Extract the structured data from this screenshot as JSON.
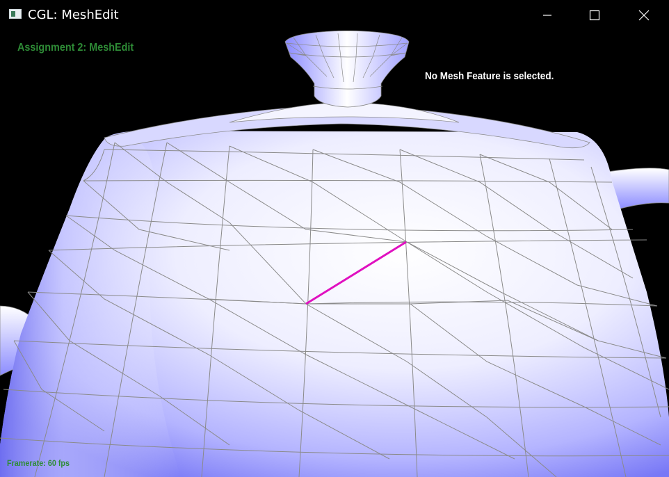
{
  "window": {
    "title": "CGL: MeshEdit",
    "controls": {
      "minimize": "minimize-icon",
      "maximize": "maximize-icon",
      "close": "close-icon"
    }
  },
  "overlay": {
    "assignment_title": "Assignment 2: MeshEdit",
    "status": "No Mesh Feature is selected.",
    "framerate": "Framerate: 60 fps"
  },
  "colors": {
    "overlay_green": "#2e8b36",
    "mesh_fill_light": "#ffffff",
    "mesh_fill_dark": "#7b7bff",
    "wireframe": "#8a8a8a",
    "highlight_edge": "#e010c0"
  }
}
